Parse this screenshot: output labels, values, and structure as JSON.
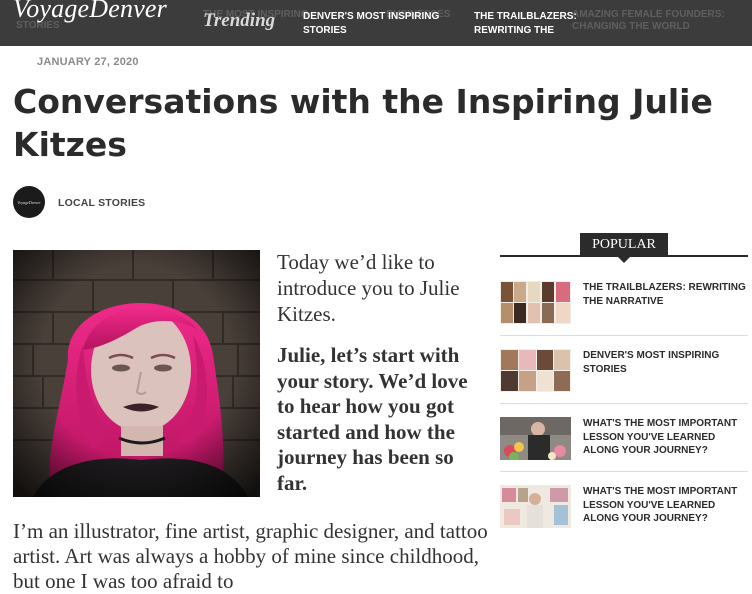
{
  "site": {
    "logo": "VoyageDenver"
  },
  "nav": {
    "ghost_items": [
      "STORIES",
      "THE MOST INSPIRING",
      "BUSINESSES",
      "AMAZING FEMALE FOUNDERS:",
      "CHANGING THE WORLD"
    ],
    "trending_label": "Trending",
    "ticker": [
      "DENVER'S MOST INSPIRING STORIES",
      "THE TRAILBLAZERS: REWRITING THE"
    ]
  },
  "article": {
    "date": "JANUARY 27, 2020",
    "title": "Conversations with the Inspiring Julie Kitzes",
    "avatar_text": "VoyageDenver",
    "category": "LOCAL STORIES",
    "intro": "Today we’d like to introduce you to Julie Kitzes.",
    "question": "Julie, let’s start with your story. We’d love to hear how you got started and how the journey has been so far.",
    "body": "I’m an illustrator, fine artist, graphic designer, and tattoo artist. Art was always a hobby of mine since childhood, but one I was too afraid to"
  },
  "sidebar": {
    "popular_label": "POPULAR",
    "items": [
      {
        "title": "THE TRAILBLAZERS: REWRITING THE NARRATIVE"
      },
      {
        "title": "DENVER'S MOST INSPIRING STORIES"
      },
      {
        "title": "WHAT'S THE MOST IMPORTANT LESSON YOU'VE LEARNED ALONG YOUR JOURNEY?"
      },
      {
        "title": "WHAT'S THE MOST IMPORTANT LESSON YOU'VE LEARNED ALONG YOUR JOURNEY?"
      }
    ]
  },
  "colors": {
    "topbar": "#3c3c3c",
    "text": "#2b2b2b",
    "hair": "#e0197a"
  }
}
